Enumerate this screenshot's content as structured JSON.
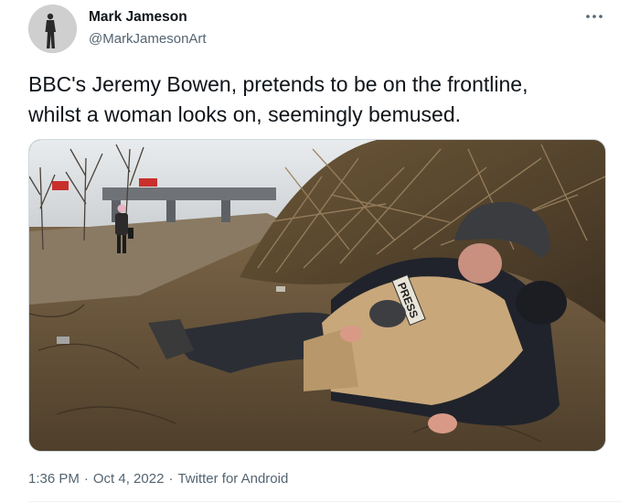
{
  "tweet": {
    "author_name": "Mark Jameson",
    "author_handle": "@MarkJamesonArt",
    "text": "BBC's Jeremy Bowen, pretends to be on the frontline,\nwhilst a woman looks on, seemingly bemused.",
    "time": "1:36 PM",
    "date": "Oct 4, 2022",
    "source": "Twitter for Android",
    "separator": "·",
    "more_icon": "more-dots-icon"
  },
  "media": {
    "vest_label": "PRESS"
  }
}
